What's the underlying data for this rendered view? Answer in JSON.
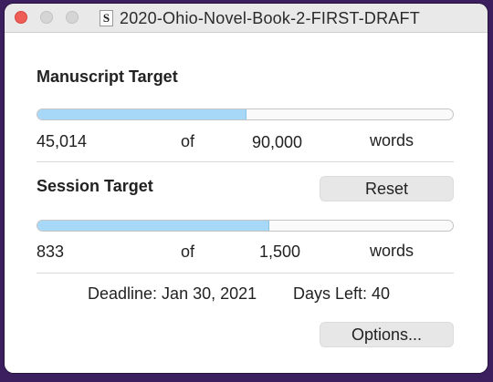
{
  "window": {
    "title": "2020-Ohio-Novel-Book-2-FIRST-DRAFT",
    "doc_icon_glyph": "S"
  },
  "manuscript": {
    "heading": "Manuscript Target",
    "current": "45,014",
    "of_label": "of",
    "target": "90,000",
    "unit": "words",
    "progress": 0.5
  },
  "session": {
    "heading": "Session Target",
    "reset_label": "Reset",
    "current": "833",
    "of_label": "of",
    "target": "1,500",
    "unit": "words",
    "progress": 0.555
  },
  "deadline": {
    "deadline_text": "Deadline: Jan 30, 2021",
    "days_left_text": "Days Left: 40"
  },
  "options_label": "Options...",
  "colors": {
    "progress_fill": "#a8d8f7",
    "close_button": "#ee5e57"
  }
}
